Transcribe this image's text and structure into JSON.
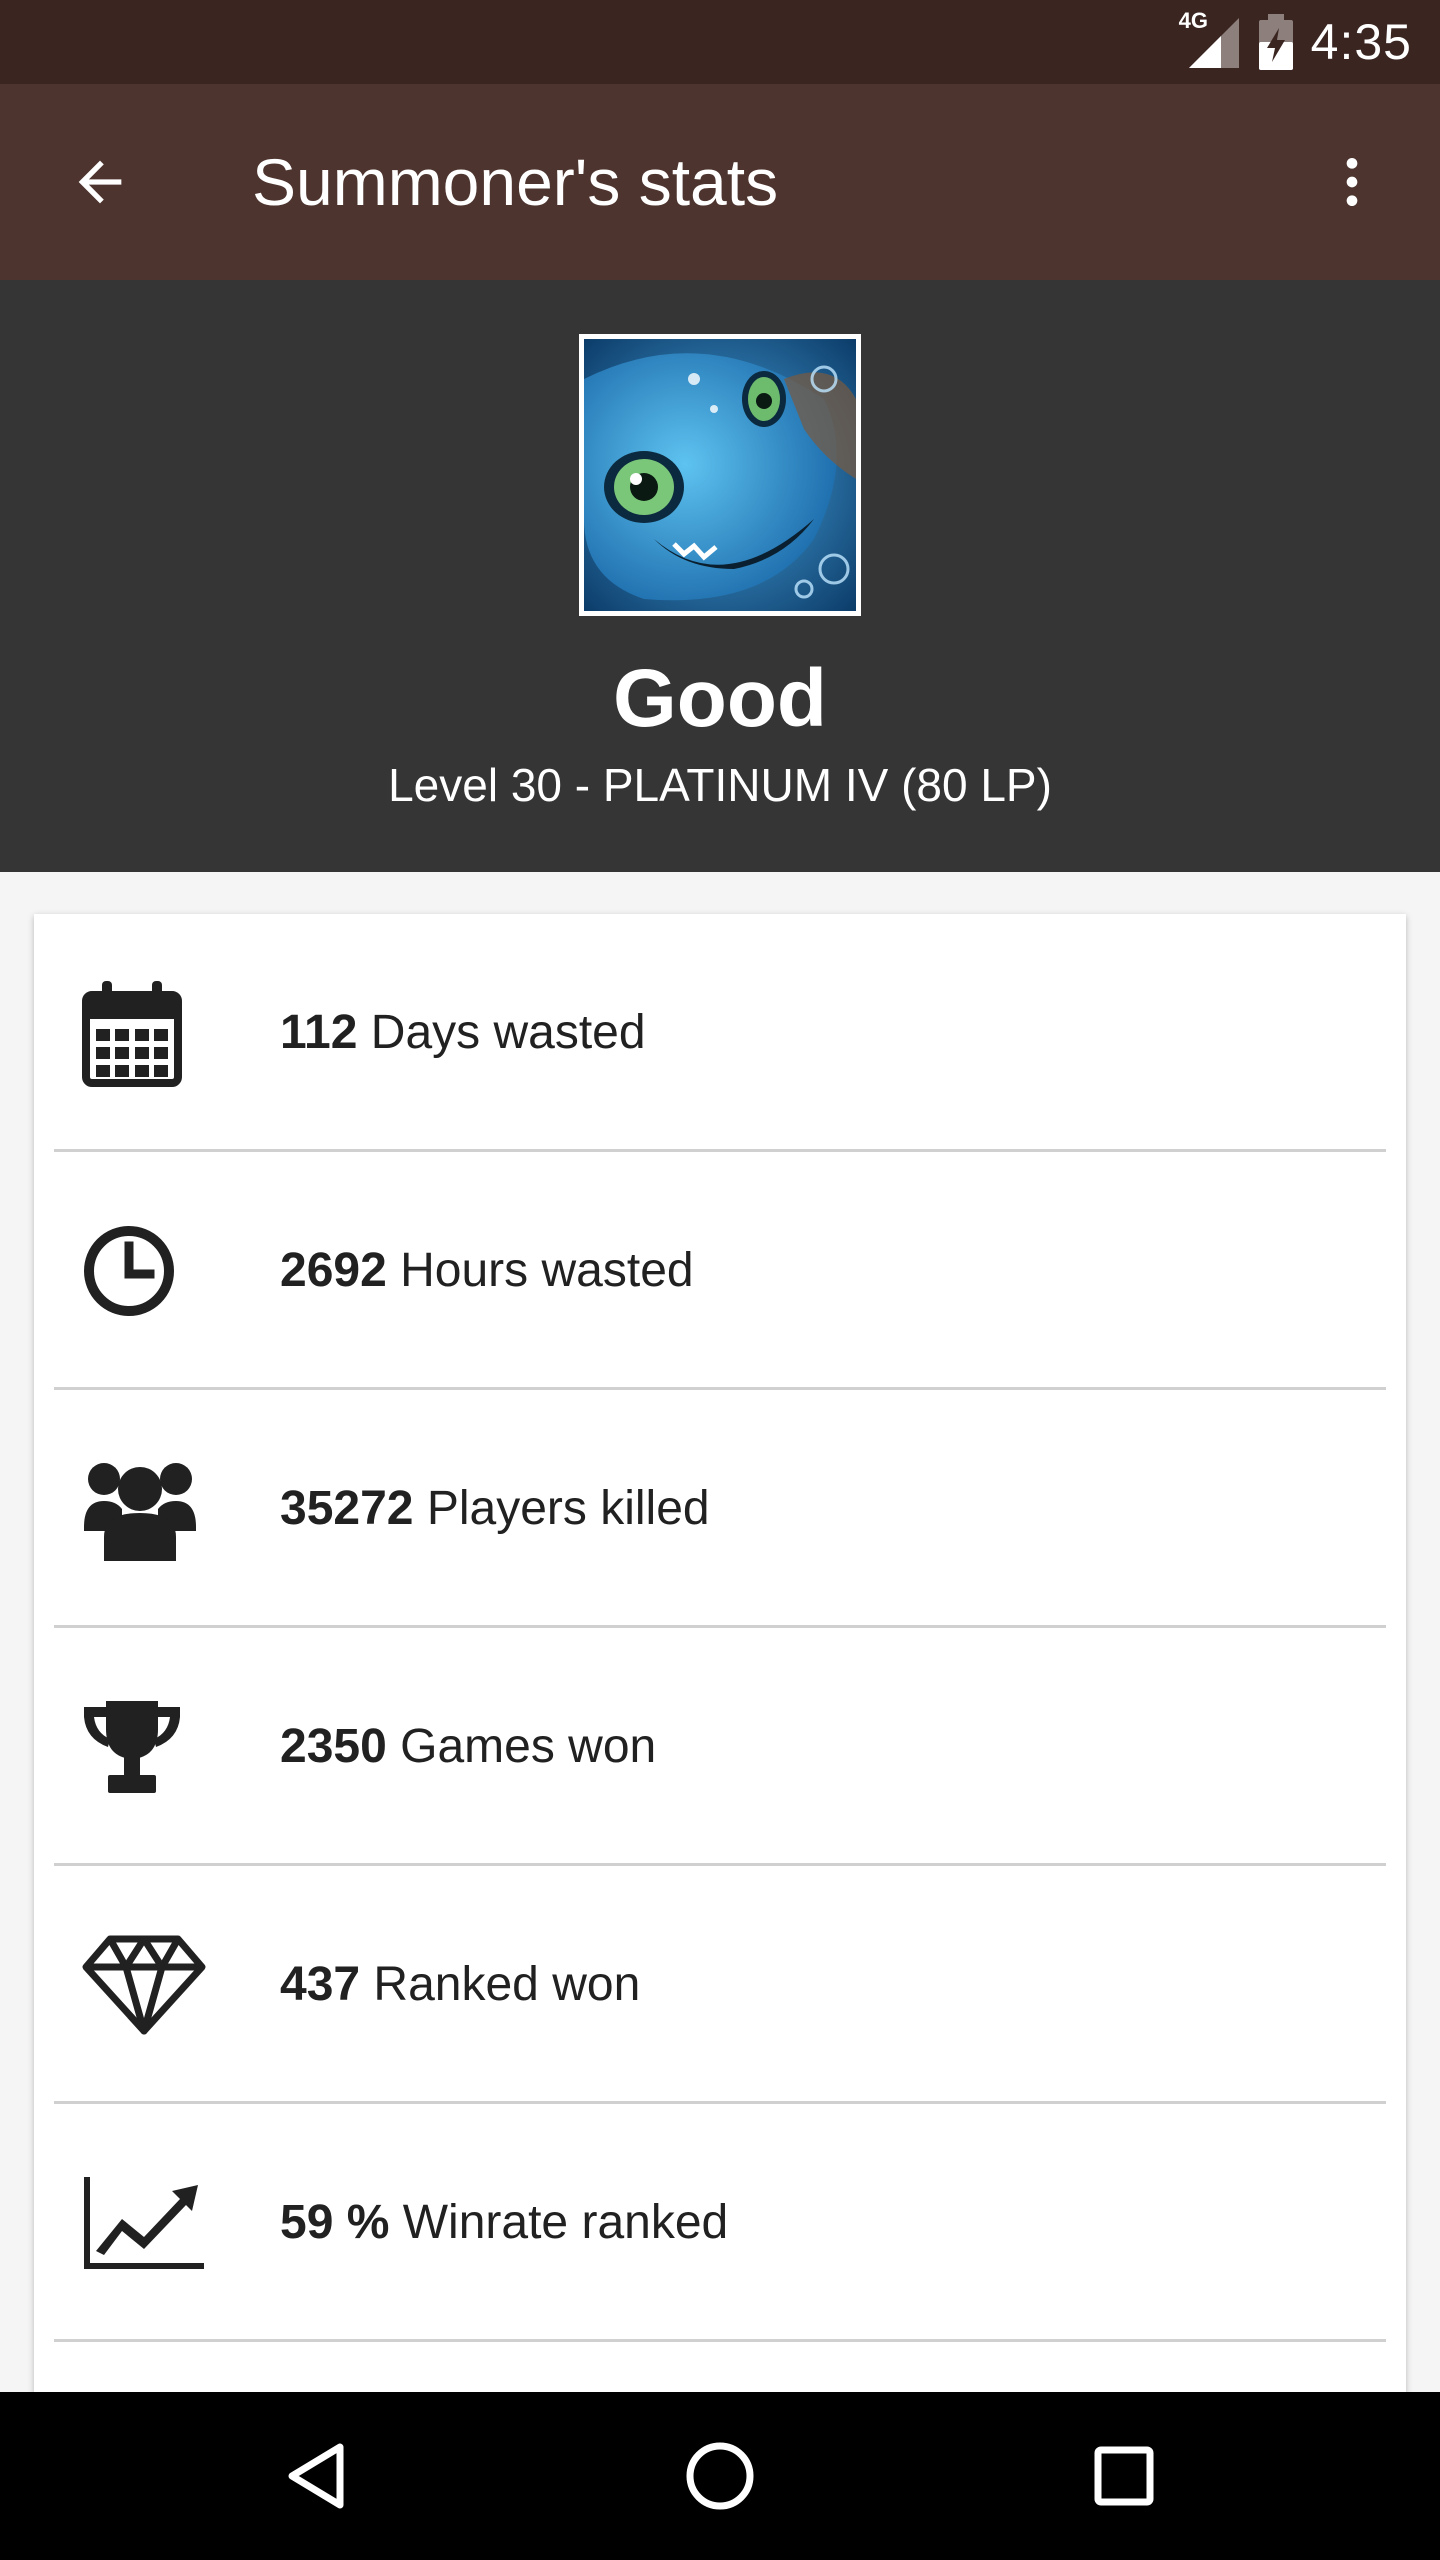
{
  "status_bar": {
    "network": "4G",
    "time": "4:35"
  },
  "app_bar": {
    "title": "Summoner's stats",
    "back_icon": "arrow-left-icon",
    "menu_icon": "more-vert-icon"
  },
  "profile": {
    "name": "Good",
    "level_text": "Level 30 - PLATINUM IV (80 LP)"
  },
  "stats": [
    {
      "icon": "calendar-icon",
      "value": "112",
      "label": " Days wasted"
    },
    {
      "icon": "clock-icon",
      "value": "2692",
      "label": " Hours wasted"
    },
    {
      "icon": "group-icon",
      "value": "35272",
      "label": " Players killed"
    },
    {
      "icon": "trophy-icon",
      "value": "2350",
      "label": " Games won"
    },
    {
      "icon": "diamond-icon",
      "value": "437",
      "label": " Ranked won"
    },
    {
      "icon": "trending-up-icon",
      "value": "59 %",
      "label": " Winrate ranked"
    }
  ],
  "colors": {
    "status_bar": "#3a2521",
    "app_bar": "#4e342e",
    "profile_bg": "#353535"
  }
}
